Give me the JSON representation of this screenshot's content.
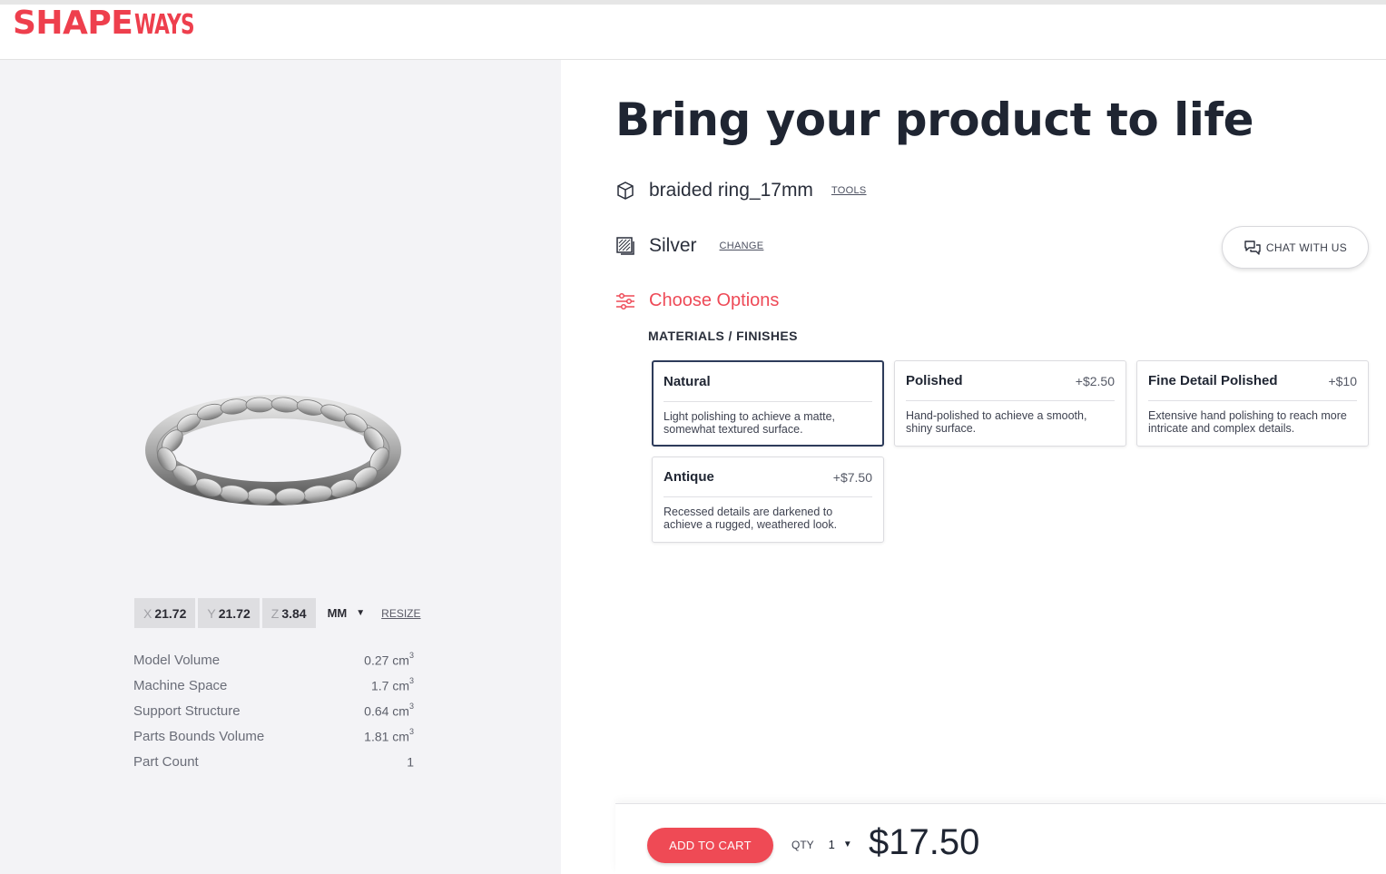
{
  "header": {
    "logo_primary": "SHAPE",
    "logo_secondary": "WAYS",
    "brand_color": "#ee3f4d"
  },
  "viewer": {
    "dimensions": [
      {
        "axis": "X",
        "value": "21.72"
      },
      {
        "axis": "Y",
        "value": "21.72"
      },
      {
        "axis": "Z",
        "value": "3.84"
      }
    ],
    "unit": "MM",
    "resize_label": "RESIZE",
    "stats": [
      {
        "label": "Model Volume",
        "value": "0.27 cm",
        "sup": "3"
      },
      {
        "label": "Machine Space",
        "value": "1.7 cm",
        "sup": "3"
      },
      {
        "label": "Support Structure",
        "value": "0.64 cm",
        "sup": "3"
      },
      {
        "label": "Parts Bounds Volume",
        "value": "1.81 cm",
        "sup": "3"
      },
      {
        "label": "Part Count",
        "value": "1",
        "sup": ""
      }
    ]
  },
  "main": {
    "title": "Bring your product to life",
    "model": {
      "name": "braided ring_17mm",
      "tools_label": "TOOLS"
    },
    "material": {
      "name": "Silver",
      "change_label": "CHANGE"
    },
    "chat_label": "CHAT WITH US",
    "choose_options": "Choose Options",
    "materials_finishes_label": "MATERIALS / FINISHES",
    "finishes": [
      {
        "name": "Natural",
        "price": "",
        "description": "Light polishing to achieve a matte, somewhat textured surface.",
        "selected": true
      },
      {
        "name": "Polished",
        "price": "+$2.50",
        "description": "Hand-polished to achieve a smooth, shiny surface.",
        "selected": false
      },
      {
        "name": "Fine Detail Polished",
        "price": "+$10",
        "description": "Extensive hand polishing to reach more intricate and complex details.",
        "selected": false
      },
      {
        "name": "Antique",
        "price": "+$7.50",
        "description": "Recessed details are darkened to achieve a rugged, weathered look.",
        "selected": false
      }
    ]
  },
  "cart": {
    "add_to_cart_label": "ADD TO CART",
    "qty_label": "QTY",
    "qty_value": "1",
    "total": "$17.50",
    "accent_color": "#ef4a55"
  }
}
